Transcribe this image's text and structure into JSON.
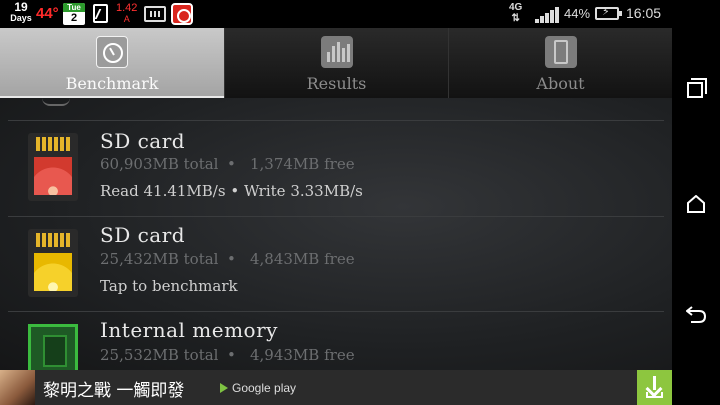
{
  "status_bar": {
    "days_number": "19",
    "days_label": "Days",
    "temperature": "44°",
    "calendar_day": "Tue",
    "calendar_date": "2",
    "speed_value": "1.42",
    "speed_unit": "A",
    "network": "4G",
    "battery": "44%",
    "time": "16:05"
  },
  "tabs": [
    {
      "label": "Benchmark",
      "icon": "gauge-icon",
      "active": true
    },
    {
      "label": "Results",
      "icon": "bar-chart-icon",
      "active": false
    },
    {
      "label": "About",
      "icon": "phone-icon",
      "active": false
    }
  ],
  "storage": [
    {
      "title": "SD card",
      "total": "60,903MB total",
      "sep": "•",
      "free": "1,374MB free",
      "info": "Read 41.41MB/s  •  Write 3.33MB/s",
      "icon": "sd-card-red-icon"
    },
    {
      "title": "SD card",
      "total": "25,432MB total",
      "sep": "•",
      "free": "4,843MB free",
      "info": "Tap to benchmark",
      "icon": "sd-card-yellow-icon"
    },
    {
      "title": "Internal memory",
      "total": "25,532MB total",
      "sep": "•",
      "free": "4,943MB free",
      "info": "",
      "icon": "memory-chip-icon"
    }
  ],
  "ad": {
    "text": "黎明之戰 一觸即發",
    "store": "Google play"
  },
  "colors": {
    "accent_green": "#8dc63f",
    "sd_red": "#e8584f",
    "sd_yellow": "#f6d12a",
    "chip_green": "#3bbb3f"
  }
}
